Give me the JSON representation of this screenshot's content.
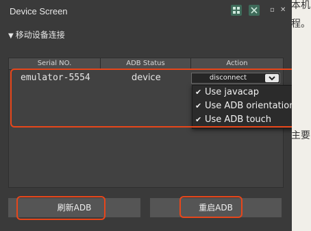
{
  "background_text": [
    "本机",
    "程。",
    "主要"
  ],
  "window": {
    "title": "Device Screen",
    "section_title": "移动设备连接"
  },
  "table": {
    "headers": [
      "Serial NO.",
      "ADB Status",
      "Action"
    ],
    "rows": [
      {
        "serial": "emulator-5554",
        "status": "device",
        "action": "disconnect"
      }
    ]
  },
  "dropdown": {
    "options": [
      "Use javacap",
      "Use ADB orientation",
      "Use ADB touch"
    ]
  },
  "buttons": {
    "refresh": "刷新ADB",
    "restart": "重启ADB"
  },
  "colors": {
    "panel_bg": "#3a3a3a",
    "highlight": "#e8461a",
    "icon_bg": "#3f6b5a"
  }
}
